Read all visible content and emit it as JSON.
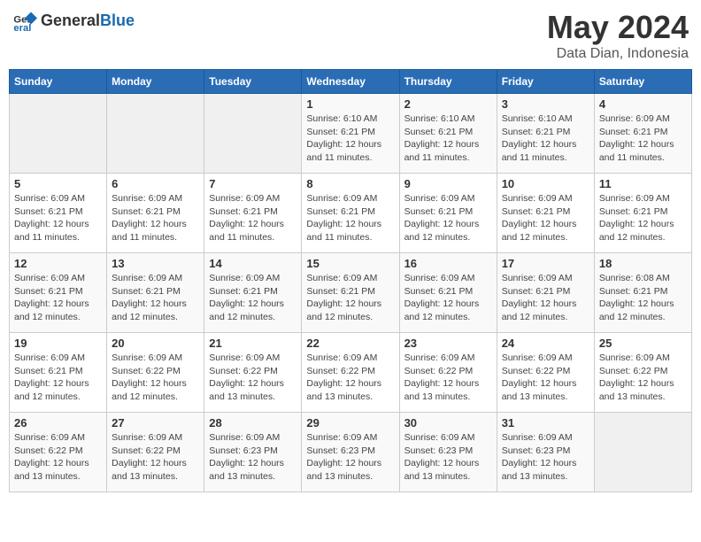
{
  "header": {
    "logo_line1": "General",
    "logo_line2": "Blue",
    "main_title": "May 2024",
    "subtitle": "Data Dian, Indonesia"
  },
  "days_of_week": [
    "Sunday",
    "Monday",
    "Tuesday",
    "Wednesday",
    "Thursday",
    "Friday",
    "Saturday"
  ],
  "weeks": [
    [
      {
        "day": "",
        "info": ""
      },
      {
        "day": "",
        "info": ""
      },
      {
        "day": "",
        "info": ""
      },
      {
        "day": "1",
        "info": "Sunrise: 6:10 AM\nSunset: 6:21 PM\nDaylight: 12 hours and 11 minutes."
      },
      {
        "day": "2",
        "info": "Sunrise: 6:10 AM\nSunset: 6:21 PM\nDaylight: 12 hours and 11 minutes."
      },
      {
        "day": "3",
        "info": "Sunrise: 6:10 AM\nSunset: 6:21 PM\nDaylight: 12 hours and 11 minutes."
      },
      {
        "day": "4",
        "info": "Sunrise: 6:09 AM\nSunset: 6:21 PM\nDaylight: 12 hours and 11 minutes."
      }
    ],
    [
      {
        "day": "5",
        "info": "Sunrise: 6:09 AM\nSunset: 6:21 PM\nDaylight: 12 hours and 11 minutes."
      },
      {
        "day": "6",
        "info": "Sunrise: 6:09 AM\nSunset: 6:21 PM\nDaylight: 12 hours and 11 minutes."
      },
      {
        "day": "7",
        "info": "Sunrise: 6:09 AM\nSunset: 6:21 PM\nDaylight: 12 hours and 11 minutes."
      },
      {
        "day": "8",
        "info": "Sunrise: 6:09 AM\nSunset: 6:21 PM\nDaylight: 12 hours and 11 minutes."
      },
      {
        "day": "9",
        "info": "Sunrise: 6:09 AM\nSunset: 6:21 PM\nDaylight: 12 hours and 12 minutes."
      },
      {
        "day": "10",
        "info": "Sunrise: 6:09 AM\nSunset: 6:21 PM\nDaylight: 12 hours and 12 minutes."
      },
      {
        "day": "11",
        "info": "Sunrise: 6:09 AM\nSunset: 6:21 PM\nDaylight: 12 hours and 12 minutes."
      }
    ],
    [
      {
        "day": "12",
        "info": "Sunrise: 6:09 AM\nSunset: 6:21 PM\nDaylight: 12 hours and 12 minutes."
      },
      {
        "day": "13",
        "info": "Sunrise: 6:09 AM\nSunset: 6:21 PM\nDaylight: 12 hours and 12 minutes."
      },
      {
        "day": "14",
        "info": "Sunrise: 6:09 AM\nSunset: 6:21 PM\nDaylight: 12 hours and 12 minutes."
      },
      {
        "day": "15",
        "info": "Sunrise: 6:09 AM\nSunset: 6:21 PM\nDaylight: 12 hours and 12 minutes."
      },
      {
        "day": "16",
        "info": "Sunrise: 6:09 AM\nSunset: 6:21 PM\nDaylight: 12 hours and 12 minutes."
      },
      {
        "day": "17",
        "info": "Sunrise: 6:09 AM\nSunset: 6:21 PM\nDaylight: 12 hours and 12 minutes."
      },
      {
        "day": "18",
        "info": "Sunrise: 6:08 AM\nSunset: 6:21 PM\nDaylight: 12 hours and 12 minutes."
      }
    ],
    [
      {
        "day": "19",
        "info": "Sunrise: 6:09 AM\nSunset: 6:21 PM\nDaylight: 12 hours and 12 minutes."
      },
      {
        "day": "20",
        "info": "Sunrise: 6:09 AM\nSunset: 6:22 PM\nDaylight: 12 hours and 12 minutes."
      },
      {
        "day": "21",
        "info": "Sunrise: 6:09 AM\nSunset: 6:22 PM\nDaylight: 12 hours and 13 minutes."
      },
      {
        "day": "22",
        "info": "Sunrise: 6:09 AM\nSunset: 6:22 PM\nDaylight: 12 hours and 13 minutes."
      },
      {
        "day": "23",
        "info": "Sunrise: 6:09 AM\nSunset: 6:22 PM\nDaylight: 12 hours and 13 minutes."
      },
      {
        "day": "24",
        "info": "Sunrise: 6:09 AM\nSunset: 6:22 PM\nDaylight: 12 hours and 13 minutes."
      },
      {
        "day": "25",
        "info": "Sunrise: 6:09 AM\nSunset: 6:22 PM\nDaylight: 12 hours and 13 minutes."
      }
    ],
    [
      {
        "day": "26",
        "info": "Sunrise: 6:09 AM\nSunset: 6:22 PM\nDaylight: 12 hours and 13 minutes."
      },
      {
        "day": "27",
        "info": "Sunrise: 6:09 AM\nSunset: 6:22 PM\nDaylight: 12 hours and 13 minutes."
      },
      {
        "day": "28",
        "info": "Sunrise: 6:09 AM\nSunset: 6:23 PM\nDaylight: 12 hours and 13 minutes."
      },
      {
        "day": "29",
        "info": "Sunrise: 6:09 AM\nSunset: 6:23 PM\nDaylight: 12 hours and 13 minutes."
      },
      {
        "day": "30",
        "info": "Sunrise: 6:09 AM\nSunset: 6:23 PM\nDaylight: 12 hours and 13 minutes."
      },
      {
        "day": "31",
        "info": "Sunrise: 6:09 AM\nSunset: 6:23 PM\nDaylight: 12 hours and 13 minutes."
      },
      {
        "day": "",
        "info": ""
      }
    ]
  ]
}
